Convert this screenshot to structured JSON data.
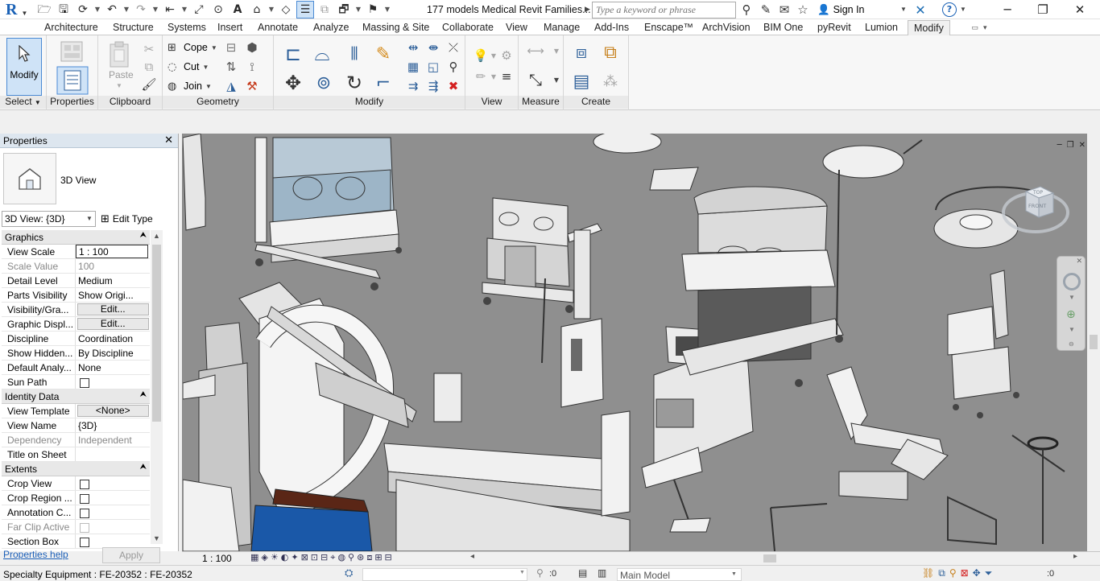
{
  "app": {
    "doc_title": "177 models Medical Revit Families...",
    "search_placeholder": "Type a keyword or phrase",
    "sign_in": "Sign In"
  },
  "quick_access": {
    "icons": [
      "open-icon",
      "save-icon",
      "sync-icon",
      "undo-icon",
      "redo-icon",
      "measure-icon",
      "dimension-icon",
      "tag-icon",
      "text-icon",
      "3d-view-icon",
      "section-icon",
      "thin-lines-icon",
      "close-hidden-icon",
      "switch-windows-icon",
      "customize-icon"
    ]
  },
  "tabs": [
    "Architecture",
    "Structure",
    "Systems",
    "Insert",
    "Annotate",
    "Analyze",
    "Massing & Site",
    "Collaborate",
    "View",
    "Manage",
    "Add-Ins",
    "Enscape™",
    "ArchVision",
    "BIM One",
    "pyRevit",
    "Lumion",
    "Modify"
  ],
  "active_tab": "Modify",
  "ribbon": {
    "modify_label": "Modify",
    "paste_label": "Paste",
    "cope_label": "Cope",
    "cut_label": "Cut",
    "join_label": "Join",
    "panels": {
      "select": "Select",
      "properties": "Properties",
      "clipboard": "Clipboard",
      "geometry": "Geometry",
      "modify": "Modify",
      "view": "View",
      "measure": "Measure",
      "create": "Create"
    }
  },
  "properties": {
    "title": "Properties",
    "type_name": "3D View",
    "type_selector": "3D View: {3D}",
    "edit_type": "Edit Type",
    "sections": {
      "graphics": "Graphics",
      "identity": "Identity Data",
      "extents": "Extents"
    },
    "graphics_rows": [
      {
        "name": "View Scale",
        "value": "1 : 100"
      },
      {
        "name": "Scale Value",
        "value_prefix": "1:",
        "value": "100"
      },
      {
        "name": "Detail Level",
        "value": "Medium"
      },
      {
        "name": "Parts Visibility",
        "value": "Show Origi..."
      },
      {
        "name": "Visibility/Gra...",
        "value": "Edit..."
      },
      {
        "name": "Graphic Displ...",
        "value": "Edit..."
      },
      {
        "name": "Discipline",
        "value": "Coordination"
      },
      {
        "name": "Show Hidden...",
        "value": "By Discipline"
      },
      {
        "name": "Default Analy...",
        "value": "None"
      },
      {
        "name": "Sun Path",
        "value": ""
      }
    ],
    "identity_rows": [
      {
        "name": "View Template",
        "value": "<None>"
      },
      {
        "name": "View Name",
        "value": "{3D}"
      },
      {
        "name": "Dependency",
        "value": "Independent"
      },
      {
        "name": "Title on Sheet",
        "value": ""
      }
    ],
    "extents_rows": [
      {
        "name": "Crop View",
        "value": ""
      },
      {
        "name": "Crop Region ...",
        "value": ""
      },
      {
        "name": "Annotation C...",
        "value": ""
      },
      {
        "name": "Far Clip Active",
        "value": ""
      },
      {
        "name": "Section Box",
        "value": ""
      }
    ],
    "help_link": "Properties help",
    "apply": "Apply"
  },
  "viewport": {
    "viewcube_top": "TOP",
    "viewcube_front": "FRONT"
  },
  "view_control_bar": {
    "scale": "1 : 100"
  },
  "status": {
    "text": "Specialty Equipment : FE-20352 : FE-20352",
    "selection_count": ":0",
    "active_model": "Main Model",
    "filter_count": ":0"
  }
}
